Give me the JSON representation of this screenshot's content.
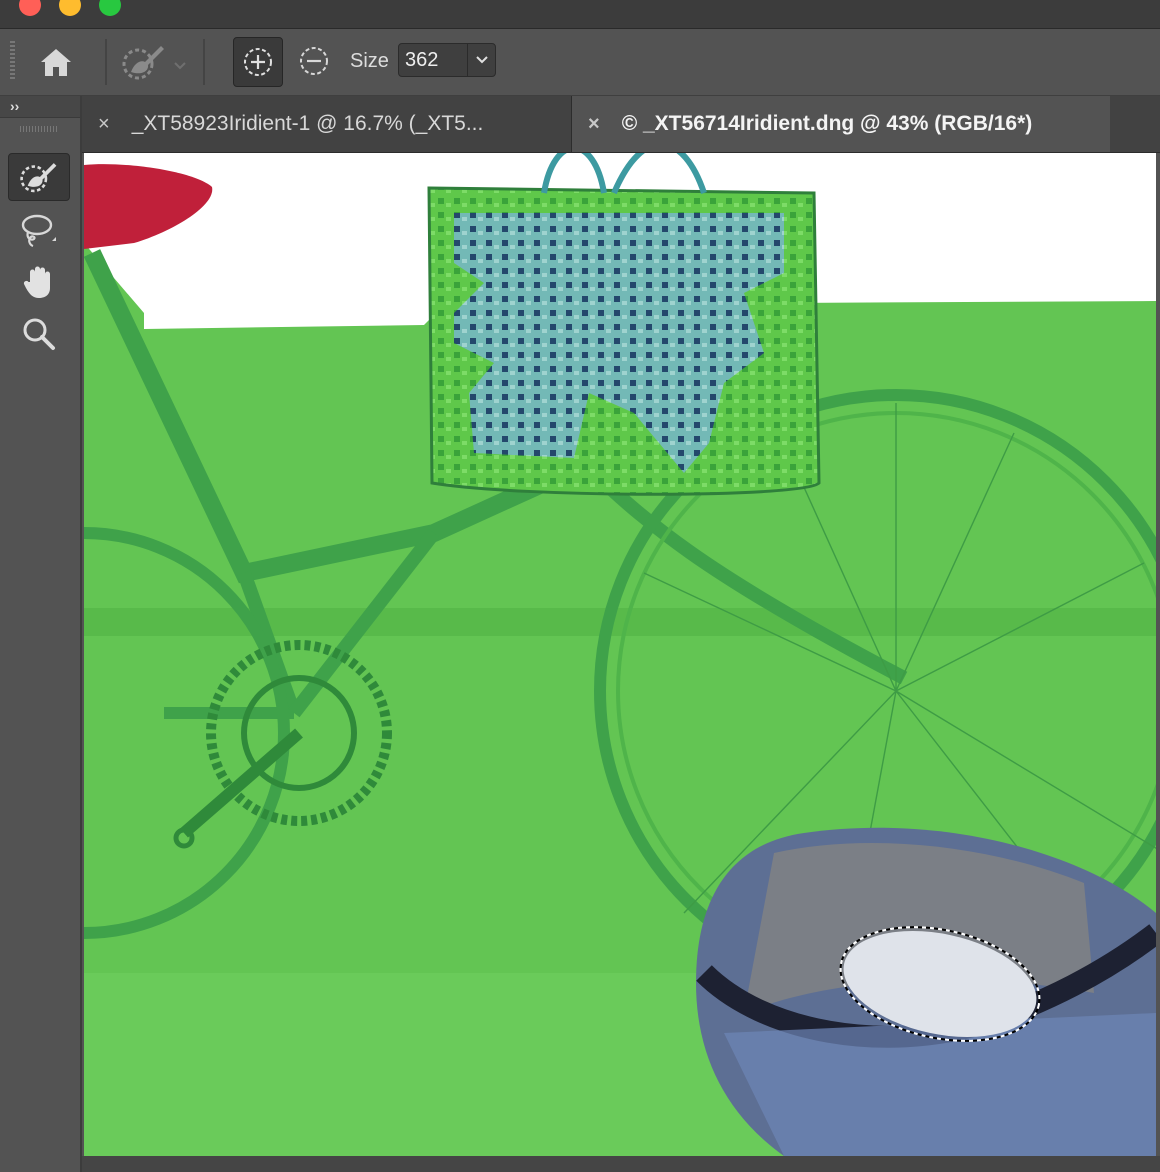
{
  "window": {
    "controls": [
      "close-dot",
      "minimize-dot",
      "zoom-dot"
    ],
    "colors": {
      "close": "#ff5f57",
      "minimize": "#febc2e",
      "zoom": "#28c840"
    }
  },
  "toolbar": {
    "home_icon": "home-icon",
    "brush_preset_icon": "select-brush-icon",
    "add_mode_icon": "circle-plus-icon",
    "subtract_mode_icon": "circle-minus-icon",
    "size_label": "Size",
    "size_value": "362"
  },
  "panel": {
    "expand_label": "››",
    "tools": [
      {
        "name": "select-brush-tool",
        "icon": "select-brush-icon",
        "active": true
      },
      {
        "name": "lasso-tool",
        "icon": "lasso-icon",
        "active": false
      },
      {
        "name": "hand-tool",
        "icon": "hand-icon",
        "active": false
      },
      {
        "name": "zoom-tool",
        "icon": "magnifier-icon",
        "active": false
      }
    ]
  },
  "tabs": [
    {
      "close": "×",
      "label": "_XT58923Iridient-1 @ 16.7% (_XT5...",
      "active": false
    },
    {
      "close": "×",
      "label": "© _XT56714Iridient.dng @ 43% (RGB/16*)",
      "active": true
    }
  ],
  "canvas": {
    "overlay_color": "#5fd04f",
    "background_color": "#ffffff"
  }
}
